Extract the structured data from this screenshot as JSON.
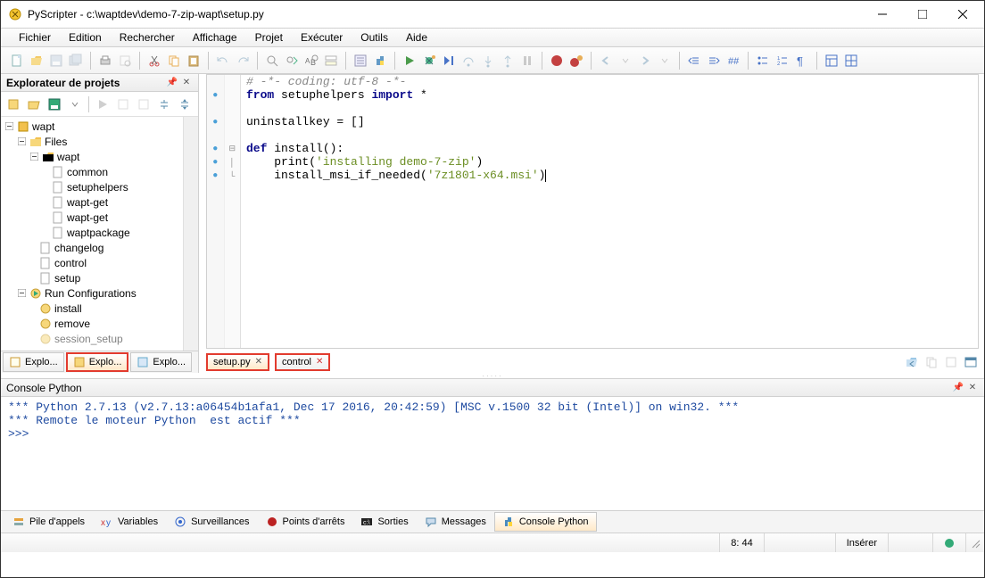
{
  "title": "PyScripter - c:\\waptdev\\demo-7-zip-wapt\\setup.py",
  "menu": [
    "Fichier",
    "Edition",
    "Rechercher",
    "Affichage",
    "Projet",
    "Exécuter",
    "Outils",
    "Aide"
  ],
  "project_explorer": {
    "title": "Explorateur de projets",
    "tree": {
      "root": "wapt",
      "files_label": "Files",
      "wapt_folder": "wapt",
      "items_wapt": [
        "common",
        "setuphelpers",
        "wapt-get",
        "wapt-get",
        "waptpackage"
      ],
      "items_root": [
        "changelog",
        "control",
        "setup"
      ],
      "run_config": "Run Configurations",
      "run_items": [
        "install",
        "remove",
        "session_setup"
      ]
    },
    "tabs": [
      "Explo...",
      "Explo...",
      "Explo..."
    ]
  },
  "code": {
    "l1": "# -*- coding: utf-8 -*-",
    "l2a": "from",
    "l2b": " setuphelpers ",
    "l2c": "import",
    "l2d": " *",
    "l3": "",
    "l4a": "uninstallkey = []",
    "l5": "",
    "l6a": "def",
    "l6b": " install",
    "l6c": "():",
    "l7a": "    print(",
    "l7b": "'installing demo-7-zip'",
    "l7c": ")",
    "l8a": "    install_msi_if_needed(",
    "l8b": "'7z1801-x64.msi'",
    "l8c": ")"
  },
  "file_tabs": {
    "setup": "setup.py",
    "control": "control"
  },
  "console": {
    "title": "Console Python",
    "l1": "*** Python 2.7.13 (v2.7.13:a06454b1afa1, Dec 17 2016, 20:42:59) [MSC v.1500 32 bit (Intel)] on win32. ***",
    "l2": "*** Remote le moteur Python  est actif ***",
    "l3": ">>> "
  },
  "bottom_tabs": [
    "Pile d'appels",
    "Variables",
    "Surveillances",
    "Points d'arrêts",
    "Sorties",
    "Messages",
    "Console Python"
  ],
  "status": {
    "pos": "8: 44",
    "mode": "Insérer"
  }
}
